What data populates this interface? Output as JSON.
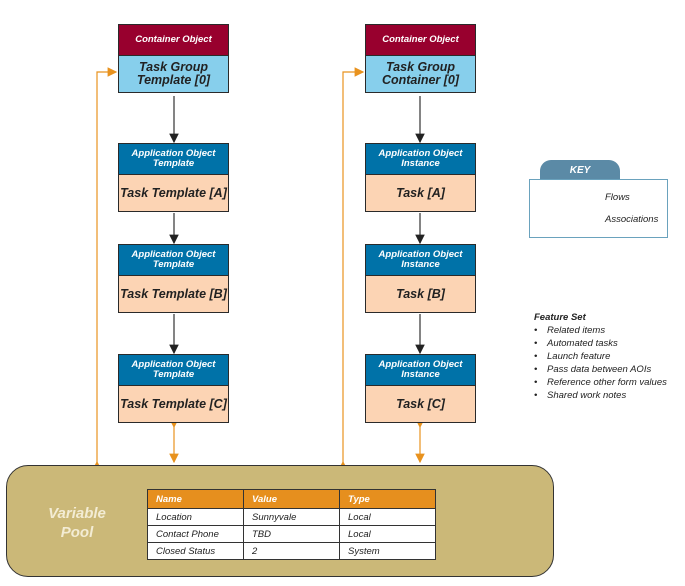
{
  "left_column": [
    {
      "header": "Container Object",
      "body": "Task Group Template [0]"
    },
    {
      "header": "Application Object Template",
      "body": "Task Template [A]"
    },
    {
      "header": "Application Object Template",
      "body": "Task Template [B]"
    },
    {
      "header": "Application Object Template",
      "body": "Task Template [C]"
    }
  ],
  "right_column": [
    {
      "header": "Container Object",
      "body": "Task Group Container [0]"
    },
    {
      "header": "Application Object Instance",
      "body": "Task [A]"
    },
    {
      "header": "Application Object Instance",
      "body": "Task [B]"
    },
    {
      "header": "Application Object Instance",
      "body": "Task [C]"
    }
  ],
  "key": {
    "title": "KEY",
    "flows": "Flows",
    "associations": "Associations"
  },
  "features": {
    "title": "Feature Set",
    "items": [
      "Related items",
      "Automated tasks",
      "Launch feature",
      "Pass data between AOIs",
      "Reference other form values",
      "Shared work notes"
    ]
  },
  "pool": {
    "label": "Variable Pool",
    "columns": [
      "Name",
      "Value",
      "Type"
    ],
    "rows": [
      [
        "Location",
        "Sunnyvale",
        "Local"
      ],
      [
        "Contact Phone",
        "TBD",
        "Local"
      ],
      [
        "Closed Status",
        "2",
        "System"
      ]
    ]
  },
  "colors": {
    "container_header": "#98002e",
    "ao_header": "#0072a8",
    "container_body": "#87cfec",
    "ao_body": "#fcd4b4",
    "flow": "#e8921e",
    "pool": "#cbb878",
    "table_header": "#e68f1e"
  }
}
